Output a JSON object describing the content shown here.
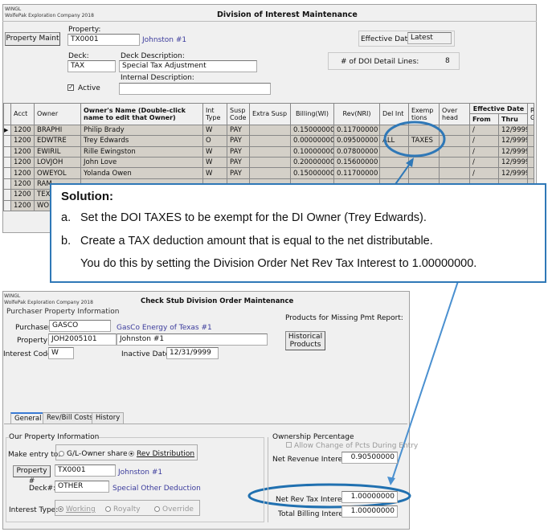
{
  "doi": {
    "app": "WINGL",
    "company": "WolfePak Exploration Company 2018",
    "title": "Division of Interest Maintenance",
    "property_maint_button": "Property Maint",
    "property_label": "Property:",
    "property": "TX0001",
    "property_name": "Johnston #1",
    "effective_date_label": "Effective Date:",
    "effective_date": "Latest",
    "deck_label": "Deck:",
    "deck": "TAX",
    "deck_desc_label": "Deck Description:",
    "deck_desc": "Special Tax Adjustment",
    "internal_desc_label": "Internal Description:",
    "internal_desc": "",
    "active_label": "Active",
    "active": true,
    "detail_lines_label": "# of DOI Detail Lines:",
    "detail_lines": "8",
    "columns": [
      "Acct",
      "Owner",
      "Owner's Name (Double-click name to edit that Owner)",
      "Int Type",
      "Susp Code",
      "Extra Susp",
      "Billing(WI)",
      "Rev(NRI)",
      "Del Int",
      "Exemp tions",
      "Over head",
      "From",
      "Thru",
      "Re Gr"
    ],
    "effective_date_header": "Effective Date",
    "rows": [
      [
        "1200",
        "BRAPHI",
        "Philip Brady",
        "W",
        "PAY",
        "",
        "0.15000000",
        "0.11700000",
        "",
        "",
        "",
        "/",
        "12/9999"
      ],
      [
        "1200",
        "EDWTRE",
        "Trey Edwards",
        "O",
        "PAY",
        "",
        "0.00000000",
        "0.09500000",
        "ALL",
        "TAXES",
        "",
        "/",
        "12/9999"
      ],
      [
        "1200",
        "EWIRIL",
        "Rille Ewingston",
        "W",
        "PAY",
        "",
        "0.10000000",
        "0.07800000",
        "",
        "",
        "",
        "/",
        "12/9999"
      ],
      [
        "1200",
        "LOVJOH",
        "John Love",
        "W",
        "PAY",
        "",
        "0.20000000",
        "0.15600000",
        "",
        "",
        "",
        "/",
        "12/9999"
      ],
      [
        "1200",
        "OWEYOL",
        "Yolanda Owen",
        "W",
        "PAY",
        "",
        "0.15000000",
        "0.11700000",
        "",
        "",
        "",
        "/",
        "12/9999"
      ],
      [
        "1200",
        "RAM",
        "",
        "",
        "",
        "",
        "",
        "",
        "",
        "",
        "",
        "",
        ""
      ],
      [
        "1200",
        "TEX",
        "",
        "",
        "",
        "",
        "",
        "",
        "",
        "",
        "",
        "",
        ""
      ],
      [
        "1200",
        "WOI",
        "",
        "",
        "",
        "",
        "",
        "",
        "",
        "",
        "",
        "",
        ""
      ]
    ]
  },
  "callout": {
    "title": "Solution:",
    "items": [
      {
        "marker": "a.",
        "text": "Set the DOI TAXES to be exempt for the DI Owner (Trey Edwards)."
      },
      {
        "marker": "b.",
        "text": "Create a TAX deduction amount that is equal to the net distributable.",
        "text2": "You do this by setting the Division Order Net Rev Tax Interest to 1.00000000."
      }
    ],
    "accent": "#2f78b7"
  },
  "csdo": {
    "app": "WINGL",
    "company": "WolfePak Exploration Company 2018",
    "title": "Check Stub Division Order Maintenance",
    "purchaser_group": "Purchaser Property Information",
    "purchaser_label": "Purchaser:",
    "purchaser": "GASCO",
    "purchaser_name": "GasCo Energy of Texas #1",
    "property_label": "Property#:",
    "property": "JOH2005101",
    "property_name": "Johnston #1",
    "interest_code_label": "Interest Code:",
    "interest_code": "W",
    "inactive_label": "Inactive Date:",
    "inactive_date": "12/31/9999",
    "products_label": "Products for Missing Pmt Report:",
    "historical_button": "Historical Products",
    "tabs": [
      "General",
      "Rev/Bill Costs",
      "History"
    ],
    "our_group": "Our Property Information",
    "make_entry_label": "Make entry to:",
    "entry_options": [
      "G/L-Owner share",
      "Rev Distribution"
    ],
    "entry_selected": "Rev Distribution",
    "property_button": "Property #",
    "our_property": "TX0001",
    "our_property_name": "Johnston #1",
    "deck_label": "Deck#:",
    "deck": "OTHER",
    "deck_name": "Special Other Deduction",
    "interest_type_label": "Interest Type:",
    "interest_types": [
      "Working",
      "Royalty",
      "Override"
    ],
    "interest_type_selected": "Working",
    "ownership_group": "Ownership Percentage",
    "allow_change_label": "Allow Change of Pcts During Entry",
    "nri_label": "Net Revenue Interest:",
    "nri": "0.90500000",
    "nrti_label": "Net Rev Tax Interest:",
    "nrti": "1.00000000",
    "tbi_label": "Total Billing Interest:",
    "tbi": "1.00000000"
  }
}
